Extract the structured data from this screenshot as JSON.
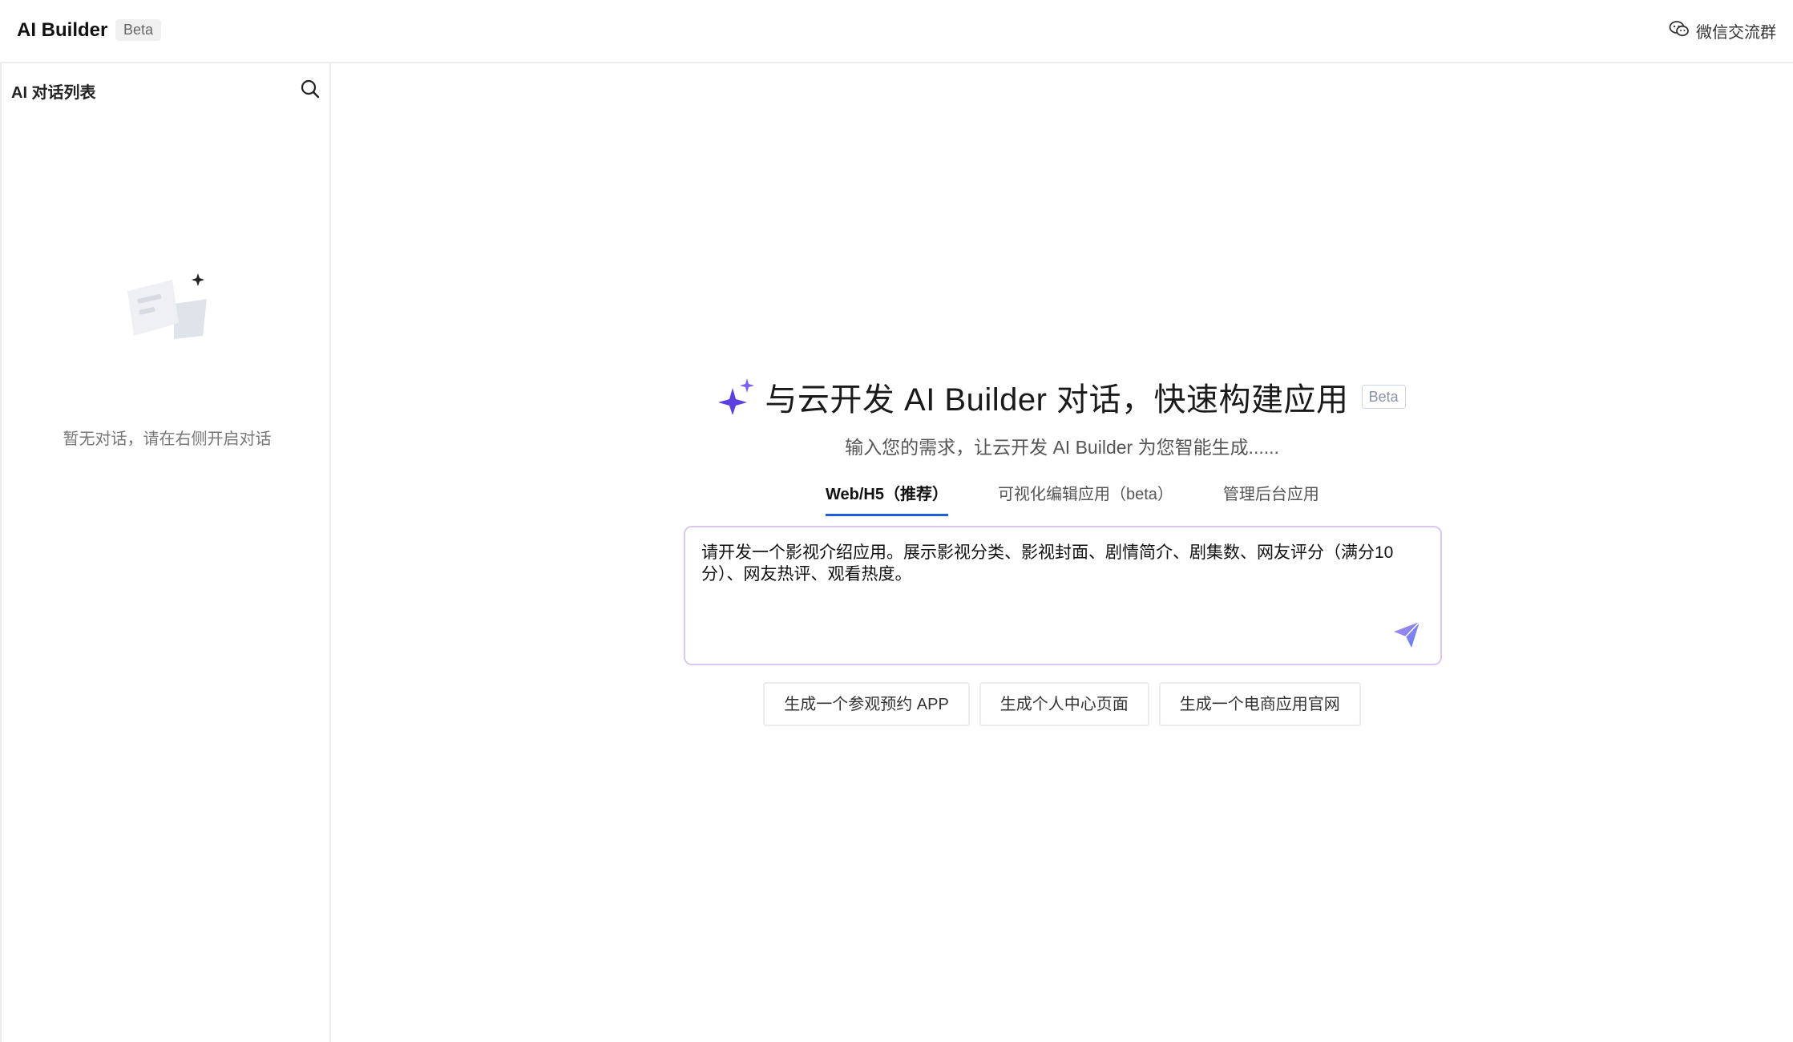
{
  "header": {
    "brand": "AI Builder",
    "brand_badge": "Beta",
    "wechat_label": "微信交流群",
    "wechat_icon": "wechat-icon"
  },
  "sidebar": {
    "title": "AI 对话列表",
    "search_icon": "search-icon",
    "empty_text": "暂无对话，请在右侧开启对话"
  },
  "main": {
    "title": "与云开发 AI Builder 对话，快速构建应用",
    "title_badge": "Beta",
    "subtitle": "输入您的需求，让云开发 AI Builder 为您智能生成......",
    "tabs": [
      {
        "label": "Web/H5（推荐）",
        "active": true
      },
      {
        "label": "可视化编辑应用（beta）",
        "active": false
      },
      {
        "label": "管理后台应用",
        "active": false
      }
    ],
    "prompt": {
      "value": "请开发一个影视介绍应用。展示影视分类、影视封面、剧情简介、剧集数、网友评分（满分10分）、网友热评、观看热度。"
    },
    "suggestions": [
      "生成一个参观预约 APP",
      "生成个人中心页面",
      "生成一个电商应用官网"
    ]
  },
  "colors": {
    "accent": "#1f5fe0",
    "sparkle": "#5b3fe0",
    "prompt_border": "#dcc7ef"
  }
}
